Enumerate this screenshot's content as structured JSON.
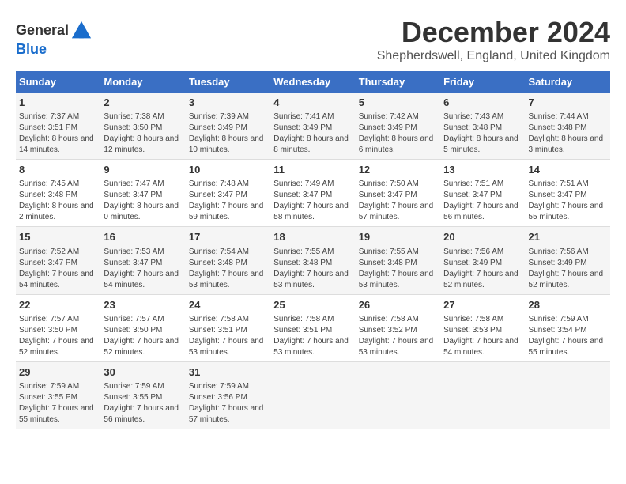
{
  "header": {
    "logo_line1": "General",
    "logo_line2": "Blue",
    "main_title": "December 2024",
    "subtitle": "Shepherdswell, England, United Kingdom"
  },
  "weekdays": [
    "Sunday",
    "Monday",
    "Tuesday",
    "Wednesday",
    "Thursday",
    "Friday",
    "Saturday"
  ],
  "weeks": [
    [
      {
        "day": "1",
        "sunrise": "Sunrise: 7:37 AM",
        "sunset": "Sunset: 3:51 PM",
        "daylight": "Daylight: 8 hours and 14 minutes."
      },
      {
        "day": "2",
        "sunrise": "Sunrise: 7:38 AM",
        "sunset": "Sunset: 3:50 PM",
        "daylight": "Daylight: 8 hours and 12 minutes."
      },
      {
        "day": "3",
        "sunrise": "Sunrise: 7:39 AM",
        "sunset": "Sunset: 3:49 PM",
        "daylight": "Daylight: 8 hours and 10 minutes."
      },
      {
        "day": "4",
        "sunrise": "Sunrise: 7:41 AM",
        "sunset": "Sunset: 3:49 PM",
        "daylight": "Daylight: 8 hours and 8 minutes."
      },
      {
        "day": "5",
        "sunrise": "Sunrise: 7:42 AM",
        "sunset": "Sunset: 3:49 PM",
        "daylight": "Daylight: 8 hours and 6 minutes."
      },
      {
        "day": "6",
        "sunrise": "Sunrise: 7:43 AM",
        "sunset": "Sunset: 3:48 PM",
        "daylight": "Daylight: 8 hours and 5 minutes."
      },
      {
        "day": "7",
        "sunrise": "Sunrise: 7:44 AM",
        "sunset": "Sunset: 3:48 PM",
        "daylight": "Daylight: 8 hours and 3 minutes."
      }
    ],
    [
      {
        "day": "8",
        "sunrise": "Sunrise: 7:45 AM",
        "sunset": "Sunset: 3:48 PM",
        "daylight": "Daylight: 8 hours and 2 minutes."
      },
      {
        "day": "9",
        "sunrise": "Sunrise: 7:47 AM",
        "sunset": "Sunset: 3:47 PM",
        "daylight": "Daylight: 8 hours and 0 minutes."
      },
      {
        "day": "10",
        "sunrise": "Sunrise: 7:48 AM",
        "sunset": "Sunset: 3:47 PM",
        "daylight": "Daylight: 7 hours and 59 minutes."
      },
      {
        "day": "11",
        "sunrise": "Sunrise: 7:49 AM",
        "sunset": "Sunset: 3:47 PM",
        "daylight": "Daylight: 7 hours and 58 minutes."
      },
      {
        "day": "12",
        "sunrise": "Sunrise: 7:50 AM",
        "sunset": "Sunset: 3:47 PM",
        "daylight": "Daylight: 7 hours and 57 minutes."
      },
      {
        "day": "13",
        "sunrise": "Sunrise: 7:51 AM",
        "sunset": "Sunset: 3:47 PM",
        "daylight": "Daylight: 7 hours and 56 minutes."
      },
      {
        "day": "14",
        "sunrise": "Sunrise: 7:51 AM",
        "sunset": "Sunset: 3:47 PM",
        "daylight": "Daylight: 7 hours and 55 minutes."
      }
    ],
    [
      {
        "day": "15",
        "sunrise": "Sunrise: 7:52 AM",
        "sunset": "Sunset: 3:47 PM",
        "daylight": "Daylight: 7 hours and 54 minutes."
      },
      {
        "day": "16",
        "sunrise": "Sunrise: 7:53 AM",
        "sunset": "Sunset: 3:47 PM",
        "daylight": "Daylight: 7 hours and 54 minutes."
      },
      {
        "day": "17",
        "sunrise": "Sunrise: 7:54 AM",
        "sunset": "Sunset: 3:48 PM",
        "daylight": "Daylight: 7 hours and 53 minutes."
      },
      {
        "day": "18",
        "sunrise": "Sunrise: 7:55 AM",
        "sunset": "Sunset: 3:48 PM",
        "daylight": "Daylight: 7 hours and 53 minutes."
      },
      {
        "day": "19",
        "sunrise": "Sunrise: 7:55 AM",
        "sunset": "Sunset: 3:48 PM",
        "daylight": "Daylight: 7 hours and 53 minutes."
      },
      {
        "day": "20",
        "sunrise": "Sunrise: 7:56 AM",
        "sunset": "Sunset: 3:49 PM",
        "daylight": "Daylight: 7 hours and 52 minutes."
      },
      {
        "day": "21",
        "sunrise": "Sunrise: 7:56 AM",
        "sunset": "Sunset: 3:49 PM",
        "daylight": "Daylight: 7 hours and 52 minutes."
      }
    ],
    [
      {
        "day": "22",
        "sunrise": "Sunrise: 7:57 AM",
        "sunset": "Sunset: 3:50 PM",
        "daylight": "Daylight: 7 hours and 52 minutes."
      },
      {
        "day": "23",
        "sunrise": "Sunrise: 7:57 AM",
        "sunset": "Sunset: 3:50 PM",
        "daylight": "Daylight: 7 hours and 52 minutes."
      },
      {
        "day": "24",
        "sunrise": "Sunrise: 7:58 AM",
        "sunset": "Sunset: 3:51 PM",
        "daylight": "Daylight: 7 hours and 53 minutes."
      },
      {
        "day": "25",
        "sunrise": "Sunrise: 7:58 AM",
        "sunset": "Sunset: 3:51 PM",
        "daylight": "Daylight: 7 hours and 53 minutes."
      },
      {
        "day": "26",
        "sunrise": "Sunrise: 7:58 AM",
        "sunset": "Sunset: 3:52 PM",
        "daylight": "Daylight: 7 hours and 53 minutes."
      },
      {
        "day": "27",
        "sunrise": "Sunrise: 7:58 AM",
        "sunset": "Sunset: 3:53 PM",
        "daylight": "Daylight: 7 hours and 54 minutes."
      },
      {
        "day": "28",
        "sunrise": "Sunrise: 7:59 AM",
        "sunset": "Sunset: 3:54 PM",
        "daylight": "Daylight: 7 hours and 55 minutes."
      }
    ],
    [
      {
        "day": "29",
        "sunrise": "Sunrise: 7:59 AM",
        "sunset": "Sunset: 3:55 PM",
        "daylight": "Daylight: 7 hours and 55 minutes."
      },
      {
        "day": "30",
        "sunrise": "Sunrise: 7:59 AM",
        "sunset": "Sunset: 3:55 PM",
        "daylight": "Daylight: 7 hours and 56 minutes."
      },
      {
        "day": "31",
        "sunrise": "Sunrise: 7:59 AM",
        "sunset": "Sunset: 3:56 PM",
        "daylight": "Daylight: 7 hours and 57 minutes."
      },
      null,
      null,
      null,
      null
    ]
  ]
}
